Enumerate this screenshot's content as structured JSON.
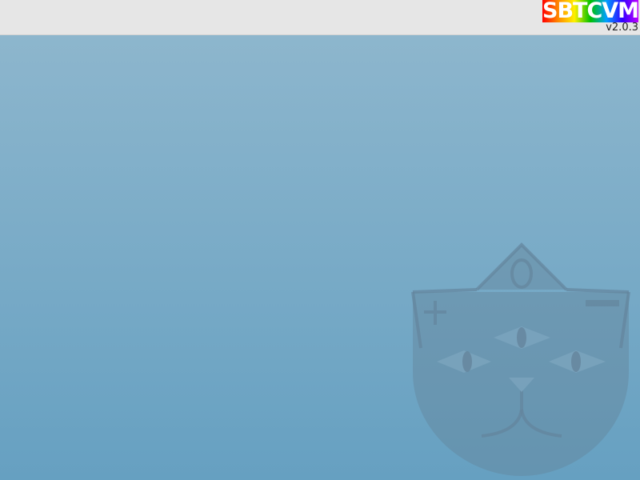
{
  "brand": {
    "logo_text": "SBTCVM",
    "version": "v2.0.3",
    "logo_gradient": [
      "#ff0000",
      "#ff8a00",
      "#fff000",
      "#00c000",
      "#00a0ff",
      "#3000ff",
      "#c000ff"
    ]
  },
  "desktop": {
    "background_top": "#8db6cd",
    "background_bottom": "#66a0c1",
    "mascot": {
      "description_icon": "cat-face-mascot-icon",
      "symbols": [
        "+",
        "0",
        "-"
      ]
    }
  }
}
